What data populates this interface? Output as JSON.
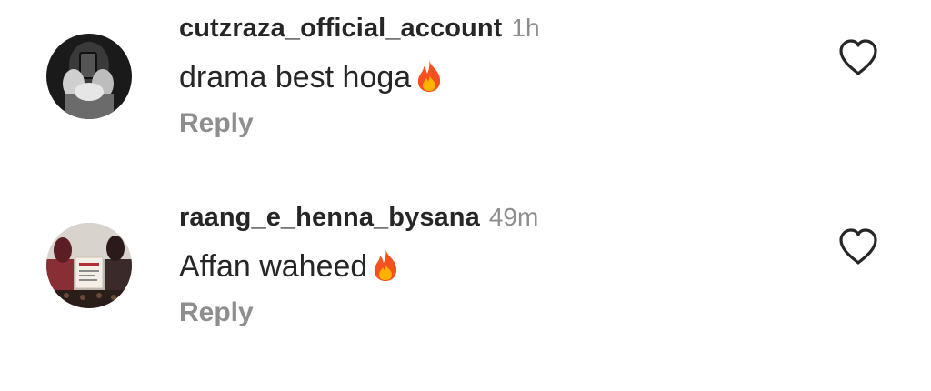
{
  "comments": [
    {
      "username": "cutzraza_official_account",
      "time": "1h",
      "text": "drama best hoga",
      "emoji": "fire",
      "reply_label": "Reply",
      "avatar_icon": "person-holding-phone-avatar"
    },
    {
      "username": "raang_e_henna_bysana",
      "time": "49m",
      "text": "Affan waheed",
      "emoji": "fire",
      "reply_label": "Reply",
      "avatar_icon": "henna-artist-avatar"
    }
  ],
  "colors": {
    "text_primary": "#262626",
    "text_secondary": "#8e8e8e",
    "heart_stroke": "#262626",
    "fire_outer": "#f4511e",
    "fire_inner": "#ffb300"
  }
}
